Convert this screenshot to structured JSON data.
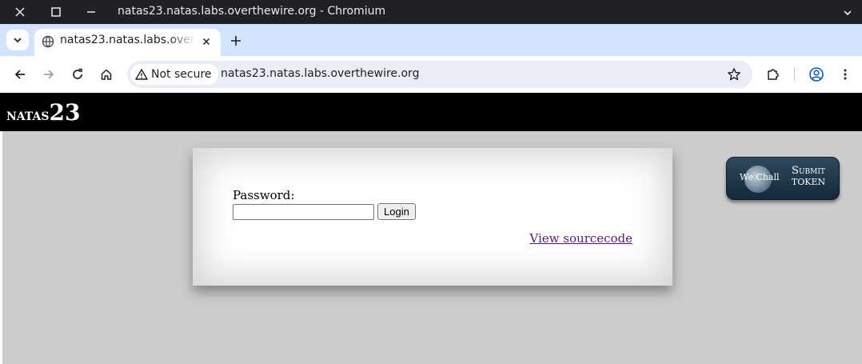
{
  "window": {
    "title": "natas23.natas.labs.overthewire.org - Chromium"
  },
  "tabs": [
    {
      "title": "natas23.natas.labs.overthewire.org",
      "active": true
    }
  ],
  "toolbar": {
    "security_label": "Not secure",
    "url": "natas23.natas.labs.overthewire.org"
  },
  "page": {
    "header": {
      "logo_name": "natas",
      "logo_number": "23"
    },
    "form": {
      "password_label": "Password:",
      "password_value": "",
      "login_label": "Login"
    },
    "view_source_label": "View sourcecode",
    "submit_token": {
      "brand": "We Chall",
      "line1": "Submit",
      "line2": "TOKEN"
    }
  },
  "colors": {
    "titlebar": "#202124",
    "tabstrip": "#d3e3fd",
    "page_background": "#cccccc",
    "header_background": "#000000",
    "link_visited": "#551a8b"
  }
}
